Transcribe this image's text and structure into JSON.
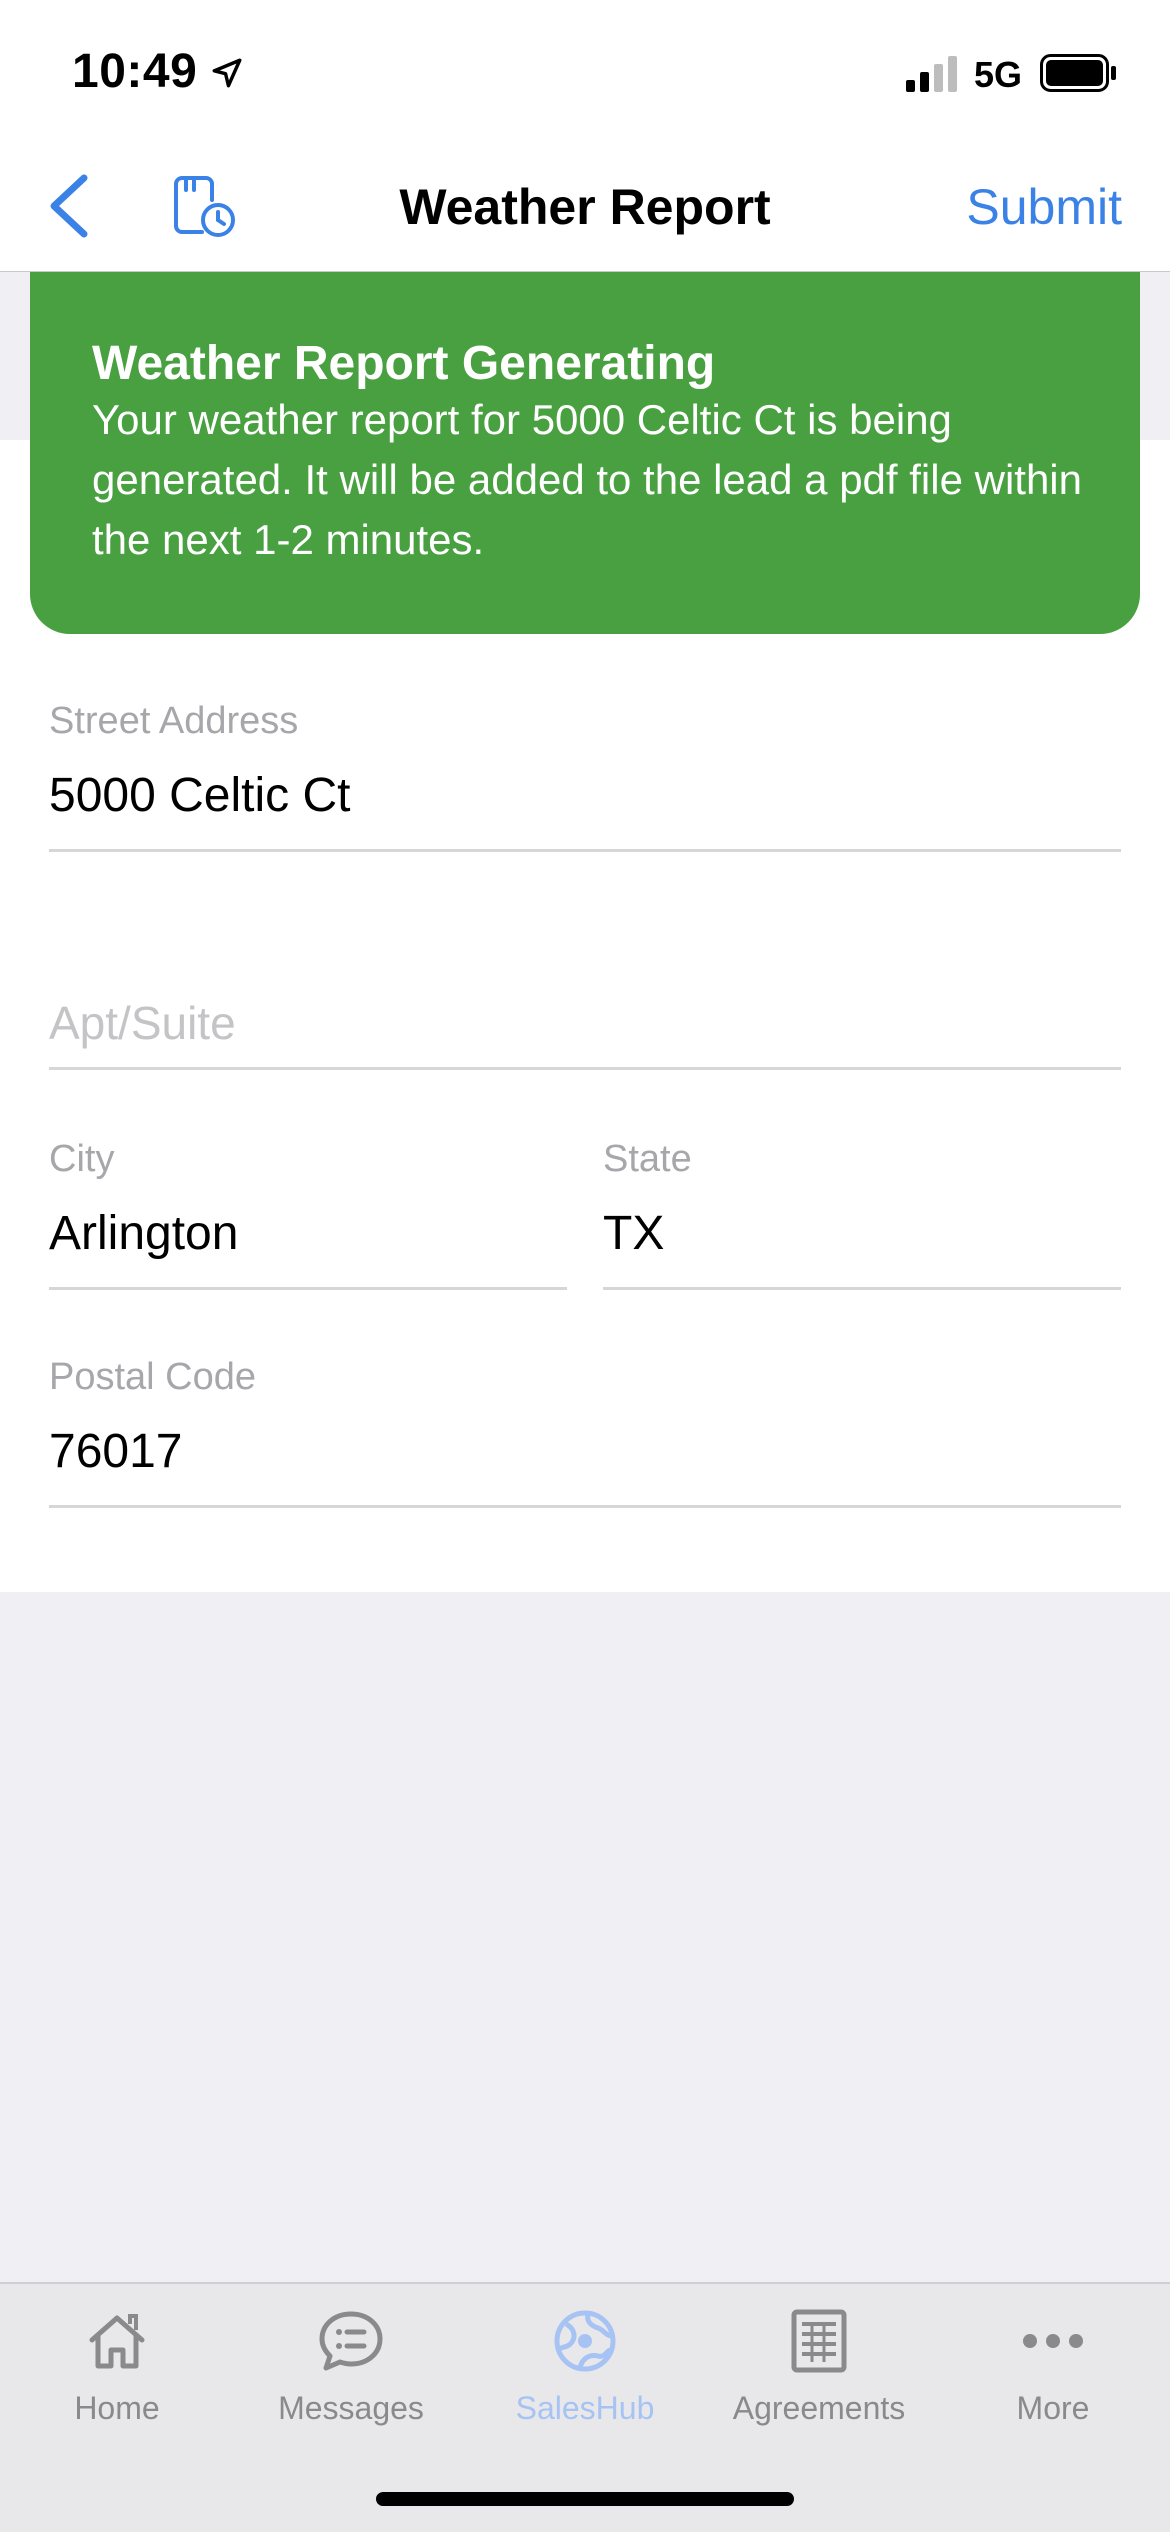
{
  "status_bar": {
    "time": "10:49",
    "network": "5G"
  },
  "nav": {
    "title": "Weather Report",
    "submit_label": "Submit"
  },
  "toast": {
    "title": "Weather Report Generating",
    "body": "Your weather report for 5000 Celtic Ct is being generated. It will be added to the lead a pdf file within the next 1-2 minutes."
  },
  "form": {
    "street": {
      "label": "Street Address",
      "value": "5000 Celtic Ct"
    },
    "apt": {
      "placeholder": "Apt/Suite"
    },
    "city": {
      "label": "City",
      "value": "Arlington"
    },
    "state": {
      "label": "State",
      "value": "TX"
    },
    "postal": {
      "label": "Postal Code",
      "value": "76017"
    }
  },
  "tabs": [
    {
      "label": "Home",
      "icon": "home-icon"
    },
    {
      "label": "Messages",
      "icon": "messages-icon"
    },
    {
      "label": "SalesHub",
      "icon": "globe-icon",
      "active": true
    },
    {
      "label": "Agreements",
      "icon": "document-icon"
    },
    {
      "label": "More",
      "icon": "more-icon"
    }
  ],
  "colors": {
    "accent": "#3b82e6",
    "toast_bg": "#49a040",
    "active_tab": "#a6c3f4",
    "inactive_tab": "#8a8a8e"
  }
}
